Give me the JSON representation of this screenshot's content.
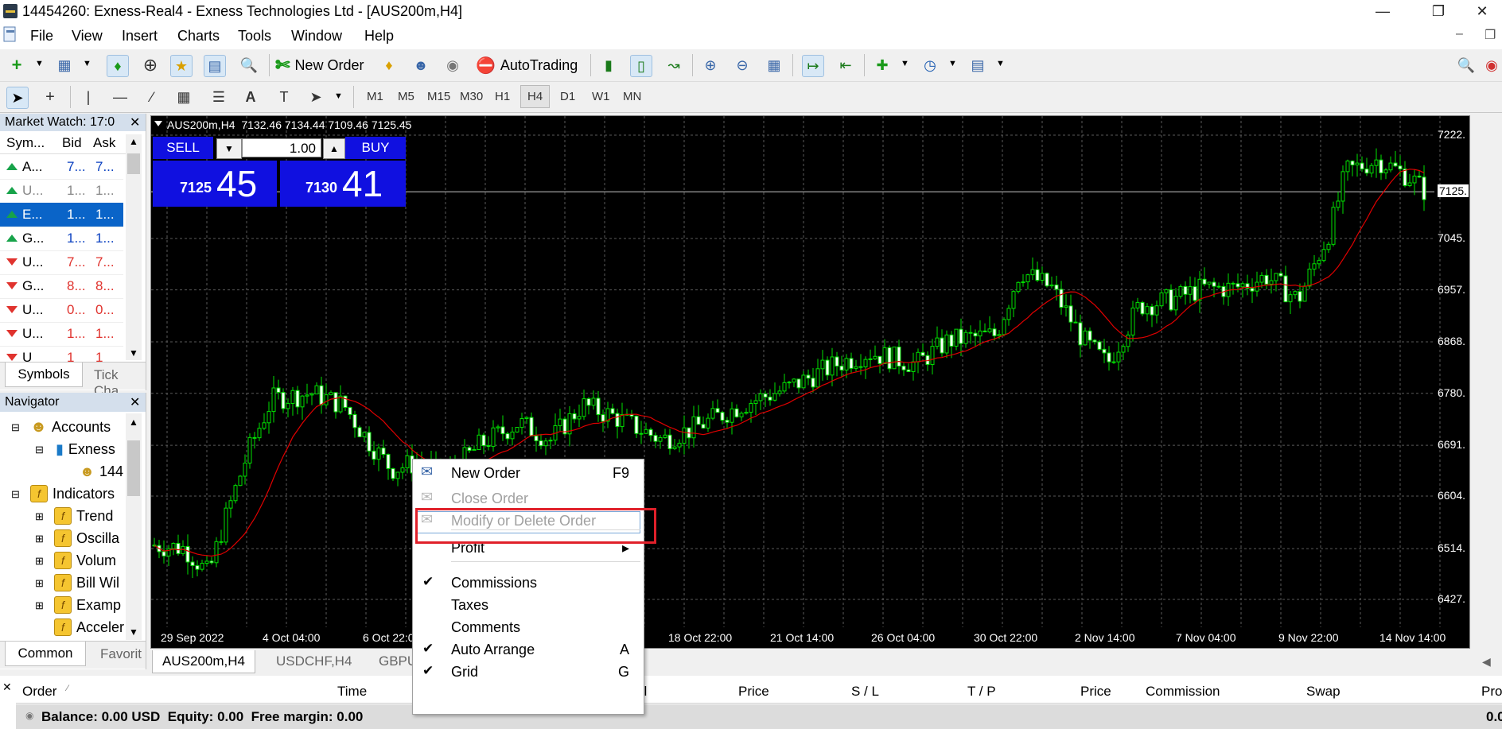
{
  "window": {
    "title": "14454260: Exness-Real4 - Exness Technologies Ltd - [AUS200m,H4]"
  },
  "menu": [
    "File",
    "View",
    "Insert",
    "Charts",
    "Tools",
    "Window",
    "Help"
  ],
  "toolbar": {
    "new_order": "New Order",
    "autotrading": "AutoTrading"
  },
  "timeframes": [
    "M1",
    "M5",
    "M15",
    "M30",
    "H1",
    "H4",
    "D1",
    "W1",
    "MN"
  ],
  "active_timeframe": "H4",
  "market_watch": {
    "title": "Market Watch: 17:0",
    "columns": [
      "Sym...",
      "Bid",
      "Ask"
    ],
    "rows": [
      {
        "sym": "A...",
        "bid": "7...",
        "ask": "7...",
        "dir": "up",
        "color": "blue",
        "selected": false
      },
      {
        "sym": "U...",
        "bid": "1...",
        "ask": "1...",
        "dir": "up",
        "color": "gray",
        "selected": false
      },
      {
        "sym": "E...",
        "bid": "1...",
        "ask": "1...",
        "dir": "up",
        "color": "white",
        "selected": true
      },
      {
        "sym": "G...",
        "bid": "1...",
        "ask": "1...",
        "dir": "up",
        "color": "blue",
        "selected": false
      },
      {
        "sym": "U...",
        "bid": "7...",
        "ask": "7...",
        "dir": "down",
        "color": "red",
        "selected": false
      },
      {
        "sym": "G...",
        "bid": "8...",
        "ask": "8...",
        "dir": "down",
        "color": "red",
        "selected": false
      },
      {
        "sym": "U...",
        "bid": "0...",
        "ask": "0...",
        "dir": "down",
        "color": "red",
        "selected": false
      },
      {
        "sym": "U...",
        "bid": "1...",
        "ask": "1...",
        "dir": "down",
        "color": "red",
        "selected": false
      },
      {
        "sym": "U",
        "bid": "1",
        "ask": "1",
        "dir": "down",
        "color": "red",
        "selected": false
      }
    ],
    "tabs": [
      "Symbols",
      "Tick Cha"
    ]
  },
  "navigator": {
    "title": "Navigator",
    "items": [
      "Accounts",
      "Exness",
      "144",
      "Indicators",
      "Trend",
      "Oscilla",
      "Volum",
      "Bill Wil",
      "Examp",
      "Acceler"
    ],
    "tabs": [
      "Common",
      "Favorit"
    ]
  },
  "chart": {
    "header": "AUS200m,H4  7132.46 7134.44 7109.46 7125.45",
    "one_click": {
      "sell": "SELL",
      "buy": "BUY",
      "lot": "1.00",
      "sell_big": "45",
      "sell_small": "7125",
      "buy_big": "41",
      "buy_small": "7130"
    },
    "price_labels": [
      "7222.",
      "7125.",
      "7045.",
      "6957.",
      "6868.",
      "6780.",
      "6691.",
      "6604.",
      "6514.",
      "6427."
    ],
    "current_price_label": "7125.",
    "x_labels": [
      "29 Sep 2022",
      "4 Oct 04:00",
      "6 Oct 22:00",
      "18 Oct 22:00",
      "21 Oct 14:00",
      "26 Oct 04:00",
      "30 Oct 22:00",
      "2 Nov 14:00",
      "7 Nov 04:00",
      "9 Nov 22:00",
      "14 Nov 14:00"
    ],
    "colors": {
      "candle": "#00e000",
      "ma": "#e00000",
      "grid": "#5a5a5a",
      "bg": "#000000"
    }
  },
  "chart_tabs": [
    "AUS200m,H4",
    "USDCHF,H4",
    "GBPU"
  ],
  "context_menu": {
    "items": [
      {
        "label": "New Order",
        "shortcut": "F9",
        "enabled": true,
        "checked": false
      },
      {
        "label": "Close Order",
        "shortcut": "",
        "enabled": false,
        "checked": false
      },
      {
        "label": "Modify or Delete Order",
        "shortcut": "",
        "enabled": false,
        "checked": false
      },
      {
        "label": "Profit",
        "shortcut": "▸",
        "enabled": true,
        "checked": false
      },
      {
        "label": "Commissions",
        "shortcut": "",
        "enabled": true,
        "checked": true
      },
      {
        "label": "Taxes",
        "shortcut": "",
        "enabled": true,
        "checked": false
      },
      {
        "label": "Comments",
        "shortcut": "",
        "enabled": true,
        "checked": false
      },
      {
        "label": "Auto Arrange",
        "shortcut": "A",
        "enabled": true,
        "checked": true
      },
      {
        "label": "Grid",
        "shortcut": "G",
        "enabled": true,
        "checked": true
      }
    ]
  },
  "terminal": {
    "columns": [
      "Order",
      "Time",
      "ol",
      "Price",
      "S / L",
      "T / P",
      "Price",
      "Commission",
      "Swap",
      "Pro"
    ],
    "balance_line": "Balance: 0.00 USD  Equity: 0.00  Free margin: 0.00",
    "balance_value": "0.0"
  }
}
